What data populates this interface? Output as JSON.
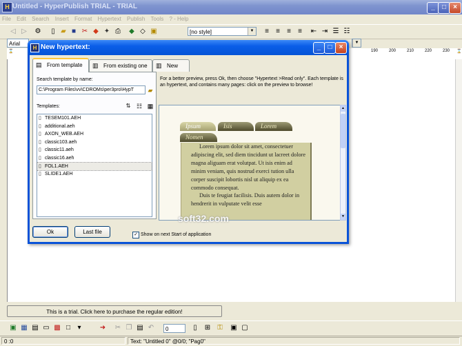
{
  "app": {
    "title": "Untitled - HyperPublish TRIAL - TRIAL",
    "icon_glyph": "H",
    "minimize": "_",
    "maximize": "□",
    "close": "×"
  },
  "menu": [
    "File",
    "Edit",
    "Search",
    "Insert",
    "Format",
    "Hypertext",
    "Publish",
    "Tools",
    "? - Help"
  ],
  "toolbar": {
    "style_combo": "[no style]",
    "font_combo": "Arial",
    "ruler_labels": [
      "190",
      "200",
      "210",
      "220",
      "230"
    ]
  },
  "dialog": {
    "title": "New hypertext:",
    "icon_glyph": "H",
    "tabs": [
      {
        "label": "From template",
        "icon": "template-icon"
      },
      {
        "label": "From existing one",
        "icon": "existing-icon"
      },
      {
        "label": "New",
        "icon": "new-icon"
      }
    ],
    "search_label": "Search template by name:",
    "search_value": "C:\\Program Files\\vv\\CDROMs\\per3pro\\HypT",
    "templates_label": "Templates:",
    "templates": [
      "TESEM101.AEH",
      "additional.aeh",
      "AXON_WEB.AEH",
      "classic103.aeh",
      "classic11.aeh",
      "classic16.aeh",
      "FOL1.AEH",
      "SLIDE1.AEH"
    ],
    "hint": "For a better preview, press Ok, then choose \"Hypertext >Read only\". Each template is an hypertext, and contains many pages: click on the preview to browse!",
    "preview_tabs": [
      "Ipsum",
      "Isis",
      "Lorem",
      "Nomen"
    ],
    "preview_text_1": "Lorem ipsum dolor sit amet, consectetuer adipiscing elit, sed diem tincidunt ut lacreet dolore magna aliguam erat volutpat. Ut isis enim ad minim veniam, quis nostrud exerci tution ulla corper suscipit lobortis nisl ut aliquip ex ea commodo consequat.",
    "preview_text_2": "Duis te feugiat facilisis. Duis autem dolor in hendrerit in vulputate velit esse",
    "ok_label": "Ok",
    "last_file_label": "Last file",
    "show_next_label": "Show on next Start of application",
    "show_next_checked": true
  },
  "trial_button": "This is a trial. Click here to purchase the regular edition!",
  "bottom_toolbar": {
    "zoom_value": "0"
  },
  "status": {
    "position": "0 :0",
    "text_info": "Text: \"Untitled 0\" @0/0; \"Pag0\""
  },
  "watermark": "soft32.com"
}
